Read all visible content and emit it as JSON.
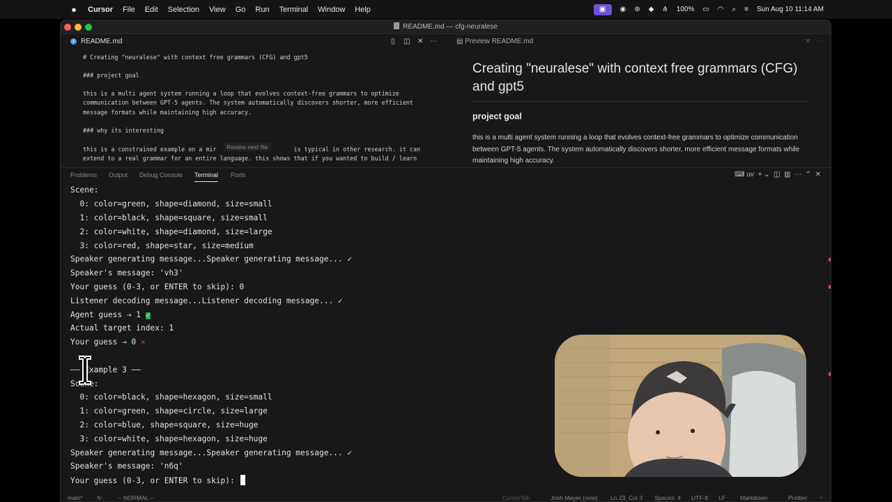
{
  "menubar": {
    "apple": "",
    "app_name": "Cursor",
    "items": [
      "File",
      "Edit",
      "Selection",
      "View",
      "Go",
      "Run",
      "Terminal",
      "Window",
      "Help"
    ],
    "battery": "100%",
    "clock": "Sun Aug 10  11:14 AM"
  },
  "window": {
    "title": "README.md — cfg-neuralese"
  },
  "editor_tab": {
    "label": "README.md"
  },
  "preview_tab": {
    "label": "Preview README.md"
  },
  "editor": {
    "lines": [
      "# Creating \"neuralese\" with context free grammars (CFG) and gpt5",
      "",
      "### project goal",
      "",
      "this is a multi agent system running a loop that evolves context-free grammars to optimize",
      "communication between GPT-5 agents. The system automatically discovers shorter, more efficient",
      "message formats while maintaining high accuracy.",
      "",
      "### why its interesting",
      "",
      "this is a constrained example on a mir                      is typical in other research. it can",
      "extend to a real grammar for an entire language. this shows that if you wanted to build / learn"
    ],
    "hint": "Review next file"
  },
  "preview": {
    "title": "Creating \"neuralese\" with context free grammars (CFG) and gpt5",
    "heading": "project goal",
    "paragraph": "this is a multi agent system running a loop that evolves context-free grammars to optimize communication between GPT-5 agents. The system automatically discovers shorter, more efficient message formats while maintaining high accuracy."
  },
  "panel": {
    "tabs": [
      "Problems",
      "Output",
      "Debug Console",
      "Terminal",
      "Ports"
    ],
    "active_tab": "Terminal",
    "shell": "uv"
  },
  "terminal": {
    "lines": [
      "Scene:",
      "  0: color=green, shape=diamond, size=small",
      "  1: color=black, shape=square, size=small",
      "  2: color=white, shape=diamond, size=large",
      "  3: color=red, shape=star, size=medium",
      "Speaker generating message...Speaker generating message... ✓",
      "Speaker's message: 'vh3'",
      "Your guess (0-3, or ENTER to skip): 0",
      "Listener decoding message...Listener decoding message... ✓",
      "Agent guess → 1",
      "Actual target index: 1",
      "Your guess → 0",
      "",
      "—— Example 3 ——",
      "Scene:",
      "  0: color=black, shape=hexagon, size=small",
      "  1: color=green, shape=circle, size=large",
      "  2: color=blue, shape=square, size=huge",
      "  3: color=white, shape=hexagon, size=huge",
      "Speaker generating message...Speaker generating message... ✓",
      "Speaker's message: 'n6q'",
      "Your guess (0-3, or ENTER to skip): "
    ],
    "ok_mark": "✓",
    "x_mark": "✕"
  },
  "statusbar": {
    "branch": "main*",
    "mode": "-- NORMAL --",
    "tab": "CursorTab",
    "author": "Josh Mayer (now)",
    "position": "Ln 23, Col 3",
    "spaces": "Spaces: 4",
    "encoding": "UTF-8",
    "eol": "LF",
    "language": "Markdown",
    "formatter": "Prettier"
  }
}
